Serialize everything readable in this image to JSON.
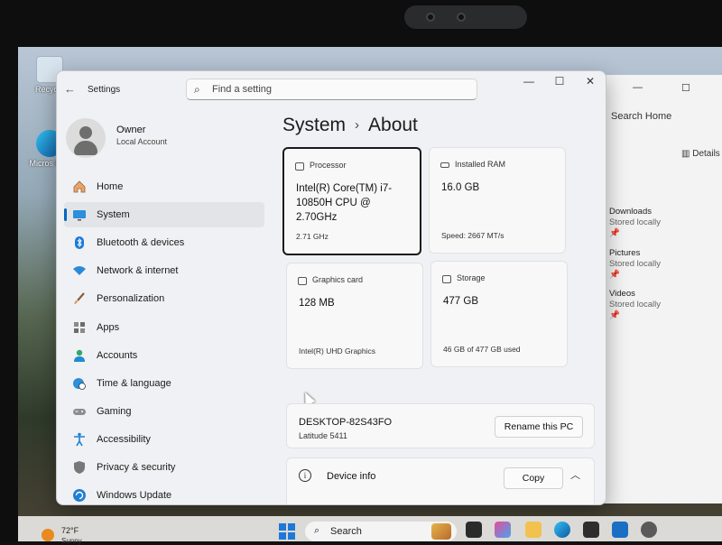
{
  "desktop": {
    "icons": [
      {
        "label": "Recycle"
      },
      {
        "label": "Micros Edg"
      }
    ]
  },
  "explorer": {
    "search_label": "Search Home",
    "details_label": "Details",
    "folders": [
      {
        "name": "Downloads",
        "status": "Stored locally"
      },
      {
        "name": "Pictures",
        "status": "Stored locally"
      },
      {
        "name": "Videos",
        "status": "Stored locally"
      }
    ]
  },
  "settings": {
    "app_title": "Settings",
    "search_placeholder": "Find a setting",
    "profile": {
      "name": "Owner",
      "account_type": "Local Account"
    },
    "nav": [
      {
        "label": "Home",
        "icon": "home-icon",
        "active": false
      },
      {
        "label": "System",
        "icon": "monitor-icon",
        "active": true
      },
      {
        "label": "Bluetooth & devices",
        "icon": "bluetooth-icon",
        "active": false
      },
      {
        "label": "Network & internet",
        "icon": "wifi-icon",
        "active": false
      },
      {
        "label": "Personalization",
        "icon": "brush-icon",
        "active": false
      },
      {
        "label": "Apps",
        "icon": "apps-icon",
        "active": false
      },
      {
        "label": "Accounts",
        "icon": "person-icon",
        "active": false
      },
      {
        "label": "Time & language",
        "icon": "globe-clock-icon",
        "active": false
      },
      {
        "label": "Gaming",
        "icon": "gamepad-icon",
        "active": false
      },
      {
        "label": "Accessibility",
        "icon": "accessibility-icon",
        "active": false
      },
      {
        "label": "Privacy & security",
        "icon": "shield-icon",
        "active": false
      },
      {
        "label": "Windows Update",
        "icon": "update-icon",
        "active": false
      }
    ],
    "breadcrumb": {
      "parent": "System",
      "separator": "›",
      "current": "About"
    },
    "specs": {
      "processor": {
        "caption": "Processor",
        "value": "Intel(R) Core(TM) i7-10850H CPU @ 2.70GHz",
        "sub": "2.71 GHz"
      },
      "ram": {
        "caption": "Installed RAM",
        "value": "16.0 GB",
        "sub": "Speed: 2667 MT/s"
      },
      "graphics": {
        "caption": "Graphics card",
        "value": "128 MB",
        "sub": "Intel(R) UHD Graphics"
      },
      "storage": {
        "caption": "Storage",
        "value": "477 GB",
        "sub": "46 GB of 477 GB used"
      }
    },
    "pc": {
      "name": "DESKTOP-82S43FO",
      "model": "Latitude 5411",
      "rename_label": "Rename this PC"
    },
    "device_info": {
      "label": "Device info",
      "copy_label": "Copy"
    }
  },
  "taskbar": {
    "weather_temp": "72°F",
    "weather_sub": "Sunny",
    "search_label": "Search"
  }
}
